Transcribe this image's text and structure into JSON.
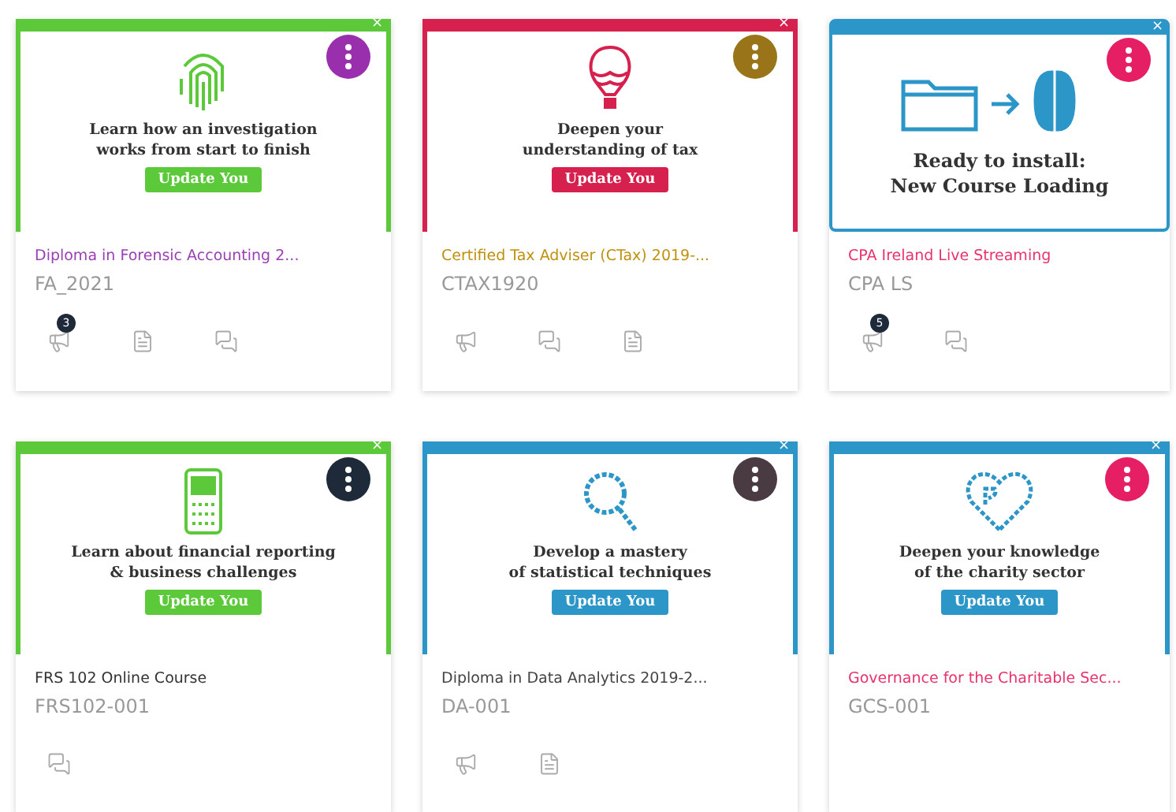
{
  "courses": [
    {
      "banner": {
        "kind": "promo",
        "color": "#5cc93a",
        "text": "Learn how an investigation\nworks from start to finish",
        "button": "Update You",
        "close": "×"
      },
      "illustration": {
        "kind": "fingerprint"
      },
      "menu": {
        "color": "#9a2fae"
      },
      "title": {
        "text": "Diploma in Forensic Accounting 2...",
        "color": "#9a3fb5"
      },
      "code": "FA_2021",
      "actions": [
        {
          "kind": "announcements",
          "badge": "3"
        },
        {
          "kind": "assignments"
        },
        {
          "kind": "discussions"
        }
      ]
    },
    {
      "banner": {
        "kind": "promo",
        "color": "#d6204e",
        "text": "Deepen your\nunderstanding of tax",
        "button": "Update You",
        "close": "×"
      },
      "illustration": {
        "kind": "balloon"
      },
      "menu": {
        "color": "#9a7418"
      },
      "title": {
        "text": "Certified Tax Adviser (CTax) 2019-...",
        "color": "#c0900f"
      },
      "code": "CTAX1920",
      "actions": [
        {
          "kind": "announcements"
        },
        {
          "kind": "discussions"
        },
        {
          "kind": "assignments"
        }
      ]
    },
    {
      "banner": {
        "kind": "install",
        "color": "#2c96c8",
        "text": "Ready to install:\nNew Course Loading",
        "close": "×"
      },
      "illustration": {
        "kind": "folder-brain"
      },
      "menu": {
        "color": "#e61e63"
      },
      "title": {
        "text": "CPA Ireland Live Streaming",
        "color": "#e8336b"
      },
      "code": "CPA LS",
      "actions": [
        {
          "kind": "announcements",
          "badge": "5"
        },
        {
          "kind": "discussions"
        }
      ]
    },
    {
      "banner": {
        "kind": "promo",
        "color": "#5cc93a",
        "text": "Learn about financial reporting\n& business challenges",
        "button": "Update You",
        "close": "×"
      },
      "illustration": {
        "kind": "calculator"
      },
      "menu": {
        "color": "#1e2a3a"
      },
      "title": {
        "text": "FRS 102 Online Course",
        "color": "#333333"
      },
      "code": "FRS102-001",
      "actions": [
        {
          "kind": "discussions"
        }
      ]
    },
    {
      "banner": {
        "kind": "promo",
        "color": "#2c96c8",
        "text": "Develop a mastery\nof statistical techniques",
        "button": "Update You",
        "close": "×"
      },
      "illustration": {
        "kind": "magnifier"
      },
      "menu": {
        "color": "#4a3a42"
      },
      "title": {
        "text": "Diploma in Data Analytics 2019-2...",
        "color": "#444444"
      },
      "code": "DA-001",
      "actions": [
        {
          "kind": "announcements"
        },
        {
          "kind": "assignments"
        }
      ]
    },
    {
      "banner": {
        "kind": "promo",
        "color": "#2c96c8",
        "text": "Deepen your knowledge\nof the charity sector",
        "button": "Update You",
        "close": "×"
      },
      "illustration": {
        "kind": "heart"
      },
      "menu": {
        "color": "#e61e63"
      },
      "title": {
        "text": "Governance for the Charitable Sec...",
        "color": "#e8336b"
      },
      "code": "GCS-001"
    }
  ]
}
